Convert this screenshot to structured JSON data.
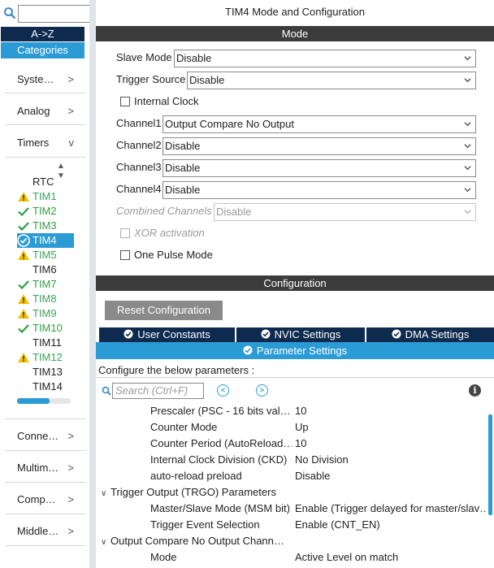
{
  "sidebar": {
    "az_label": "A->Z",
    "categories_label": "Categories",
    "categories": [
      {
        "label": "Syste…",
        "chevron": ">"
      },
      {
        "label": "Analog",
        "chevron": ">"
      },
      {
        "label": "Timers",
        "chevron": "v"
      }
    ],
    "timers": [
      {
        "label": "RTC",
        "status": "none"
      },
      {
        "label": "TIM1",
        "status": "warning"
      },
      {
        "label": "TIM2",
        "status": "ok"
      },
      {
        "label": "TIM3",
        "status": "ok"
      },
      {
        "label": "TIM4",
        "status": "selected"
      },
      {
        "label": "TIM5",
        "status": "warning"
      },
      {
        "label": "TIM6",
        "status": "none"
      },
      {
        "label": "TIM7",
        "status": "ok"
      },
      {
        "label": "TIM8",
        "status": "warning"
      },
      {
        "label": "TIM9",
        "status": "warning"
      },
      {
        "label": "TIM10",
        "status": "ok"
      },
      {
        "label": "TIM11",
        "status": "none"
      },
      {
        "label": "TIM12",
        "status": "warning"
      },
      {
        "label": "TIM13",
        "status": "none"
      },
      {
        "label": "TIM14",
        "status": "none"
      }
    ],
    "more_categories": [
      {
        "label": "Conne…",
        "chevron": ">"
      },
      {
        "label": "Multim…",
        "chevron": ">"
      },
      {
        "label": "Comp…",
        "chevron": ">"
      },
      {
        "label": "Middle…",
        "chevron": ">"
      }
    ]
  },
  "main": {
    "title": "TIM4 Mode and Configuration",
    "mode_header": "Mode",
    "slave_mode": {
      "label": "Slave Mode",
      "value": "Disable"
    },
    "trigger_source": {
      "label": "Trigger Source",
      "value": "Disable"
    },
    "internal_clock": {
      "label": "Internal Clock",
      "checked": false
    },
    "channel1": {
      "label": "Channel1",
      "value": "Output Compare No Output"
    },
    "channel2": {
      "label": "Channel2",
      "value": "Disable"
    },
    "channel3": {
      "label": "Channel3",
      "value": "Disable"
    },
    "channel4": {
      "label": "Channel4",
      "value": "Disable"
    },
    "combined_channels": {
      "label": "Combined Channels",
      "value": "Disable"
    },
    "xor_activation": {
      "label": "XOR activation",
      "checked": false
    },
    "one_pulse_mode": {
      "label": "One Pulse Mode",
      "checked": false
    },
    "config_header": "Configuration",
    "reset_label": "Reset Configuration",
    "tabs": {
      "user_constants": "User Constants",
      "nvic": "NVIC Settings",
      "dma": "DMA Settings",
      "parameter": "Parameter Settings"
    },
    "configure_label": "Configure the below parameters :",
    "search_placeholder": "Search (Ctrl+F)",
    "params": [
      {
        "name": "Prescaler (PSC - 16 bits val…",
        "value": "10"
      },
      {
        "name": "Counter Mode",
        "value": "Up"
      },
      {
        "name": "Counter Period (AutoReload…",
        "value": "10"
      },
      {
        "name": "Internal Clock Division (CKD)",
        "value": "No Division"
      },
      {
        "name": "auto-reload preload",
        "value": "Disable"
      }
    ],
    "group_trgo": "Trigger Output (TRGO) Parameters",
    "trgo_params": [
      {
        "name": "Master/Slave Mode (MSM bit)",
        "value": "Enable (Trigger delayed for master/slav…"
      },
      {
        "name": "Trigger Event Selection",
        "value": "Enable (CNT_EN)"
      }
    ],
    "group_oc": "Output Compare No Output Chann…",
    "oc_params": [
      {
        "name": "Mode",
        "value": "Active Level on match"
      }
    ]
  },
  "colors": {
    "accent": "#2b9bd6",
    "dark_tab": "#0e2a4e",
    "header_bar": "#3c3c3c",
    "ok": "#2ea043",
    "warning": "#f2c200"
  }
}
